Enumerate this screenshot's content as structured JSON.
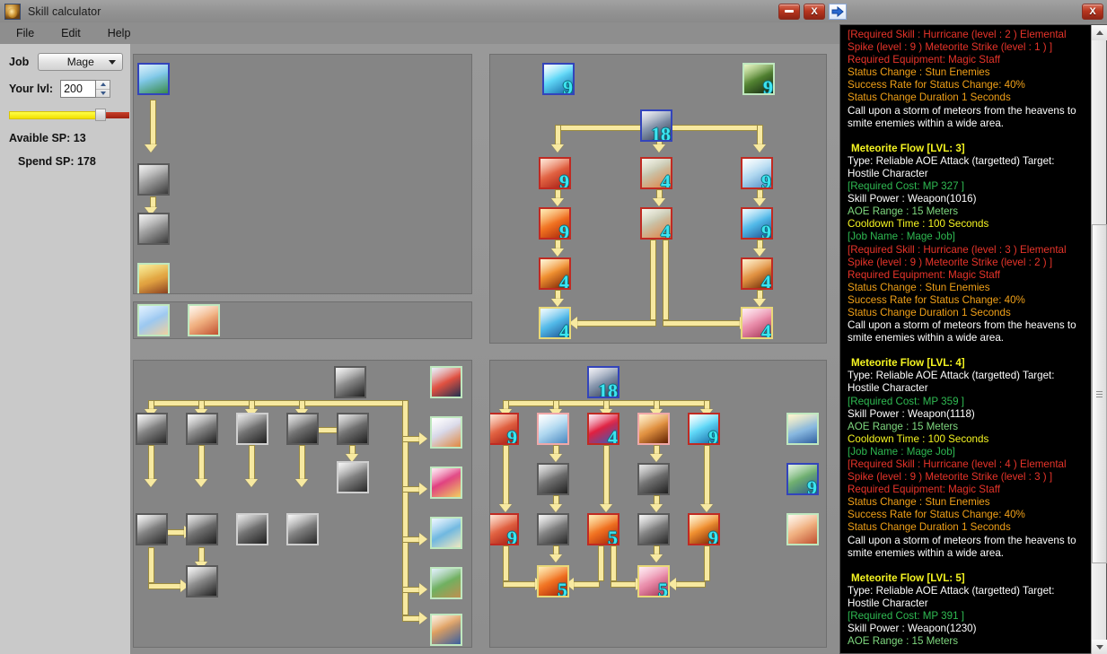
{
  "window": {
    "title": "Skill calculator",
    "icon": "app-icon",
    "minimize_label": "—",
    "close_label": "X",
    "restore_label": "X",
    "forward_icon": "blue-arrow-right-icon"
  },
  "menu": {
    "items": [
      "File",
      "Edit",
      "Help"
    ]
  },
  "sidebar": {
    "job_label": "Job",
    "job_value": "Mage",
    "job_options": [
      "Mage"
    ],
    "level_label": "Your lvl:",
    "level_value": "200",
    "available_sp_label": "Avaible SP: 13",
    "spend_sp_label": "Spend SP: 178",
    "slider": {
      "yellow_pct": 78,
      "red_pct": 22
    }
  },
  "trees": {
    "top_left": {
      "nodes": [
        {
          "id": "tl-1",
          "art": "a-sky",
          "border": "b-blue",
          "level": ""
        },
        {
          "id": "tl-2",
          "art": "a-hands",
          "border": "b-gray",
          "level": ""
        },
        {
          "id": "tl-3",
          "art": "a-hands",
          "border": "b-gray",
          "level": ""
        },
        {
          "id": "tl-4",
          "art": "a-wiz",
          "border": "b-green",
          "level": ""
        }
      ]
    },
    "top_left_strip": {
      "nodes": [
        {
          "id": "tls-1",
          "art": "a-bless",
          "border": "b-green",
          "level": ""
        },
        {
          "id": "tls-2",
          "art": "a-heal",
          "border": "b-green",
          "level": ""
        }
      ]
    },
    "top_right": {
      "nodes": [
        {
          "id": "tr-a",
          "art": "a-burst",
          "border": "b-blue",
          "level": "9"
        },
        {
          "id": "tr-b",
          "art": "a-brain",
          "border": "b-green",
          "level": "9"
        },
        {
          "id": "tr-root",
          "art": "a-clock",
          "border": "b-blue",
          "level": "18"
        },
        {
          "id": "tr-c1r1",
          "art": "a-red",
          "border": "b-red",
          "level": "9"
        },
        {
          "id": "tr-c2r1",
          "art": "a-wind",
          "border": "b-red",
          "level": "4"
        },
        {
          "id": "tr-c3r1",
          "art": "a-snow",
          "border": "b-red",
          "level": "9"
        },
        {
          "id": "tr-c1r2",
          "art": "a-fire",
          "border": "b-red",
          "level": "9"
        },
        {
          "id": "tr-c2r2",
          "art": "a-wind",
          "border": "b-red",
          "level": "4"
        },
        {
          "id": "tr-c3r2",
          "art": "a-ice",
          "border": "b-red",
          "level": "9"
        },
        {
          "id": "tr-c1r3",
          "art": "a-meteor",
          "border": "b-red",
          "level": "4"
        },
        {
          "id": "tr-c3r3",
          "art": "a-stun",
          "border": "b-red",
          "level": "4"
        },
        {
          "id": "tr-c1r4",
          "art": "a-ice",
          "border": "b-gold",
          "level": "4"
        },
        {
          "id": "tr-c3r4",
          "art": "a-pink",
          "border": "b-gold",
          "level": "4"
        }
      ]
    },
    "bottom_left": {
      "nodes": [
        {
          "id": "bl-root",
          "art": "a-skull",
          "border": "b-gray",
          "level": ""
        },
        {
          "id": "bl-c1r1",
          "art": "a-grayp",
          "border": "b-gray",
          "level": ""
        },
        {
          "id": "bl-c2r1",
          "art": "a-skull",
          "border": "b-gray",
          "level": ""
        },
        {
          "id": "bl-c3r1",
          "art": "a-dark",
          "border": "b-ltgray",
          "level": ""
        },
        {
          "id": "bl-c4r1",
          "art": "a-dark",
          "border": "b-gray",
          "level": ""
        },
        {
          "id": "bl-c5r1",
          "art": "a-dark",
          "border": "b-gray",
          "level": ""
        },
        {
          "id": "bl-c5r2",
          "art": "a-grayp",
          "border": "b-ltgray",
          "level": ""
        },
        {
          "id": "bl-c1r3",
          "art": "a-grayp",
          "border": "b-gray",
          "level": ""
        },
        {
          "id": "bl-c2r3",
          "art": "a-dark",
          "border": "b-gray",
          "level": ""
        },
        {
          "id": "bl-c3r3",
          "art": "a-dark",
          "border": "b-ltgray",
          "level": ""
        },
        {
          "id": "bl-c4r3",
          "art": "a-grayp",
          "border": "b-ltgray",
          "level": ""
        },
        {
          "id": "bl-c2r4",
          "art": "a-skull",
          "border": "b-gray",
          "level": ""
        }
      ],
      "side_nodes": [
        {
          "id": "bls-1",
          "art": "a-cat",
          "border": "b-green",
          "level": ""
        },
        {
          "id": "bls-2",
          "art": "a-bird",
          "border": "b-green",
          "level": ""
        },
        {
          "id": "bls-3",
          "art": "a-targ",
          "border": "b-green",
          "level": ""
        },
        {
          "id": "bls-4",
          "art": "a-rune",
          "border": "b-green",
          "level": ""
        },
        {
          "id": "bls-5",
          "art": "a-tree",
          "border": "b-green",
          "level": ""
        },
        {
          "id": "bls-6",
          "art": "a-body",
          "border": "b-green",
          "level": ""
        }
      ]
    },
    "bottom_right": {
      "nodes": [
        {
          "id": "br-root",
          "art": "a-clock",
          "border": "b-blue",
          "level": "18"
        },
        {
          "id": "br-c1r1",
          "art": "a-red",
          "border": "b-red",
          "level": "9"
        },
        {
          "id": "br-c2r1",
          "art": "a-snow",
          "border": "b-pink",
          "level": ""
        },
        {
          "id": "br-c3r1",
          "art": "a-circ",
          "border": "b-red",
          "level": "4"
        },
        {
          "id": "br-c4r1",
          "art": "a-stun",
          "border": "b-pink",
          "level": ""
        },
        {
          "id": "br-c5r1",
          "art": "a-burst",
          "border": "b-red",
          "level": "9"
        },
        {
          "id": "br-c2r2",
          "art": "a-dark",
          "border": "b-gray",
          "level": ""
        },
        {
          "id": "br-c4r2",
          "art": "a-dark",
          "border": "b-gray",
          "level": ""
        },
        {
          "id": "br-c1r3",
          "art": "a-red",
          "border": "b-red",
          "level": "9"
        },
        {
          "id": "br-c2r3",
          "art": "a-grayp",
          "border": "b-gray",
          "level": ""
        },
        {
          "id": "br-c3r3",
          "art": "a-fire",
          "border": "b-red",
          "level": "5"
        },
        {
          "id": "br-c4r3",
          "art": "a-grayp",
          "border": "b-gray",
          "level": ""
        },
        {
          "id": "br-c5r3",
          "art": "a-meteor",
          "border": "b-red",
          "level": "9"
        },
        {
          "id": "br-c2r4",
          "art": "a-fire",
          "border": "b-gold",
          "level": "5"
        },
        {
          "id": "br-c4r4",
          "art": "a-pink",
          "border": "b-gold",
          "level": "5"
        }
      ],
      "side_nodes": [
        {
          "id": "brs-1",
          "art": "a-eye",
          "border": "b-green",
          "level": ""
        },
        {
          "id": "brs-2",
          "art": "a-leaf",
          "border": "b-blue",
          "level": "9"
        },
        {
          "id": "brs-3",
          "art": "a-heal",
          "border": "b-green",
          "level": ""
        }
      ]
    }
  },
  "description": {
    "blocks": [
      {
        "lines": [
          {
            "color": "c-red",
            "text": "[Required Skill : Hurricane (level : 2 ) Elemental Spike (level : 9 ) Meteorite Strike (level : 1 ) ]"
          },
          {
            "color": "c-red",
            "text": "Required Equipment: Magic Staff"
          },
          {
            "color": "c-orange",
            "text": "Status Change : Stun Enemies"
          },
          {
            "color": "c-orange",
            "text": "Success Rate for Status Change: 40%"
          },
          {
            "color": "c-orange",
            "text": "Status Change Duration 1 Seconds"
          },
          {
            "color": "c-white",
            "text": "Call upon a storm of meteors from the heavens to smite enemies within a wide area."
          }
        ]
      },
      {
        "title": "Meteorite Flow [LVL: 3]",
        "lines": [
          {
            "color": "c-white",
            "text": "Type: Reliable AOE Attack (targetted) Target: Hostile Character"
          },
          {
            "color": "c-green",
            "text": "[Required Cost: MP 327 ]"
          },
          {
            "color": "c-white",
            "text": "Skill Power : Weapon(1016)"
          },
          {
            "color": "c-ltgreen",
            "text": "AOE Range : 15 Meters"
          },
          {
            "color": "c-yellow",
            "text": "Cooldown Time : 100 Seconds"
          },
          {
            "color": "c-green",
            "text": "[Job Name : Mage Job]"
          },
          {
            "color": "c-red",
            "text": "[Required Skill : Hurricane (level : 3 ) Elemental Spike (level : 9 ) Meteorite Strike (level : 2 ) ]"
          },
          {
            "color": "c-red",
            "text": "Required Equipment: Magic Staff"
          },
          {
            "color": "c-orange",
            "text": "Status Change : Stun Enemies"
          },
          {
            "color": "c-orange",
            "text": "Success Rate for Status Change: 40%"
          },
          {
            "color": "c-orange",
            "text": "Status Change Duration 1 Seconds"
          },
          {
            "color": "c-white",
            "text": "Call upon a storm of meteors from the heavens to smite enemies within a wide area."
          }
        ]
      },
      {
        "title": "Meteorite Flow [LVL: 4]",
        "lines": [
          {
            "color": "c-white",
            "text": "Type: Reliable AOE Attack (targetted) Target: Hostile Character"
          },
          {
            "color": "c-green",
            "text": "[Required Cost: MP 359 ]"
          },
          {
            "color": "c-white",
            "text": "Skill Power : Weapon(1118)"
          },
          {
            "color": "c-ltgreen",
            "text": "AOE Range : 15 Meters"
          },
          {
            "color": "c-yellow",
            "text": "Cooldown Time : 100 Seconds"
          },
          {
            "color": "c-green",
            "text": "[Job Name : Mage Job]"
          },
          {
            "color": "c-red",
            "text": "[Required Skill : Hurricane (level : 4 ) Elemental Spike (level : 9 ) Meteorite Strike (level : 3 ) ]"
          },
          {
            "color": "c-red",
            "text": "Required Equipment: Magic Staff"
          },
          {
            "color": "c-orange",
            "text": "Status Change : Stun Enemies"
          },
          {
            "color": "c-orange",
            "text": "Success Rate for Status Change: 40%"
          },
          {
            "color": "c-orange",
            "text": "Status Change Duration 1 Seconds"
          },
          {
            "color": "c-white",
            "text": "Call upon a storm of meteors from the heavens to smite enemies within a wide area."
          }
        ]
      },
      {
        "title": "Meteorite Flow [LVL: 5]",
        "lines": [
          {
            "color": "c-white",
            "text": "Type: Reliable AOE Attack (targetted) Target: Hostile Character"
          },
          {
            "color": "c-green",
            "text": "[Required Cost: MP 391 ]"
          },
          {
            "color": "c-white",
            "text": "Skill Power : Weapon(1230)"
          },
          {
            "color": "c-ltgreen",
            "text": "AOE Range : 15 Meters"
          }
        ]
      }
    ]
  }
}
